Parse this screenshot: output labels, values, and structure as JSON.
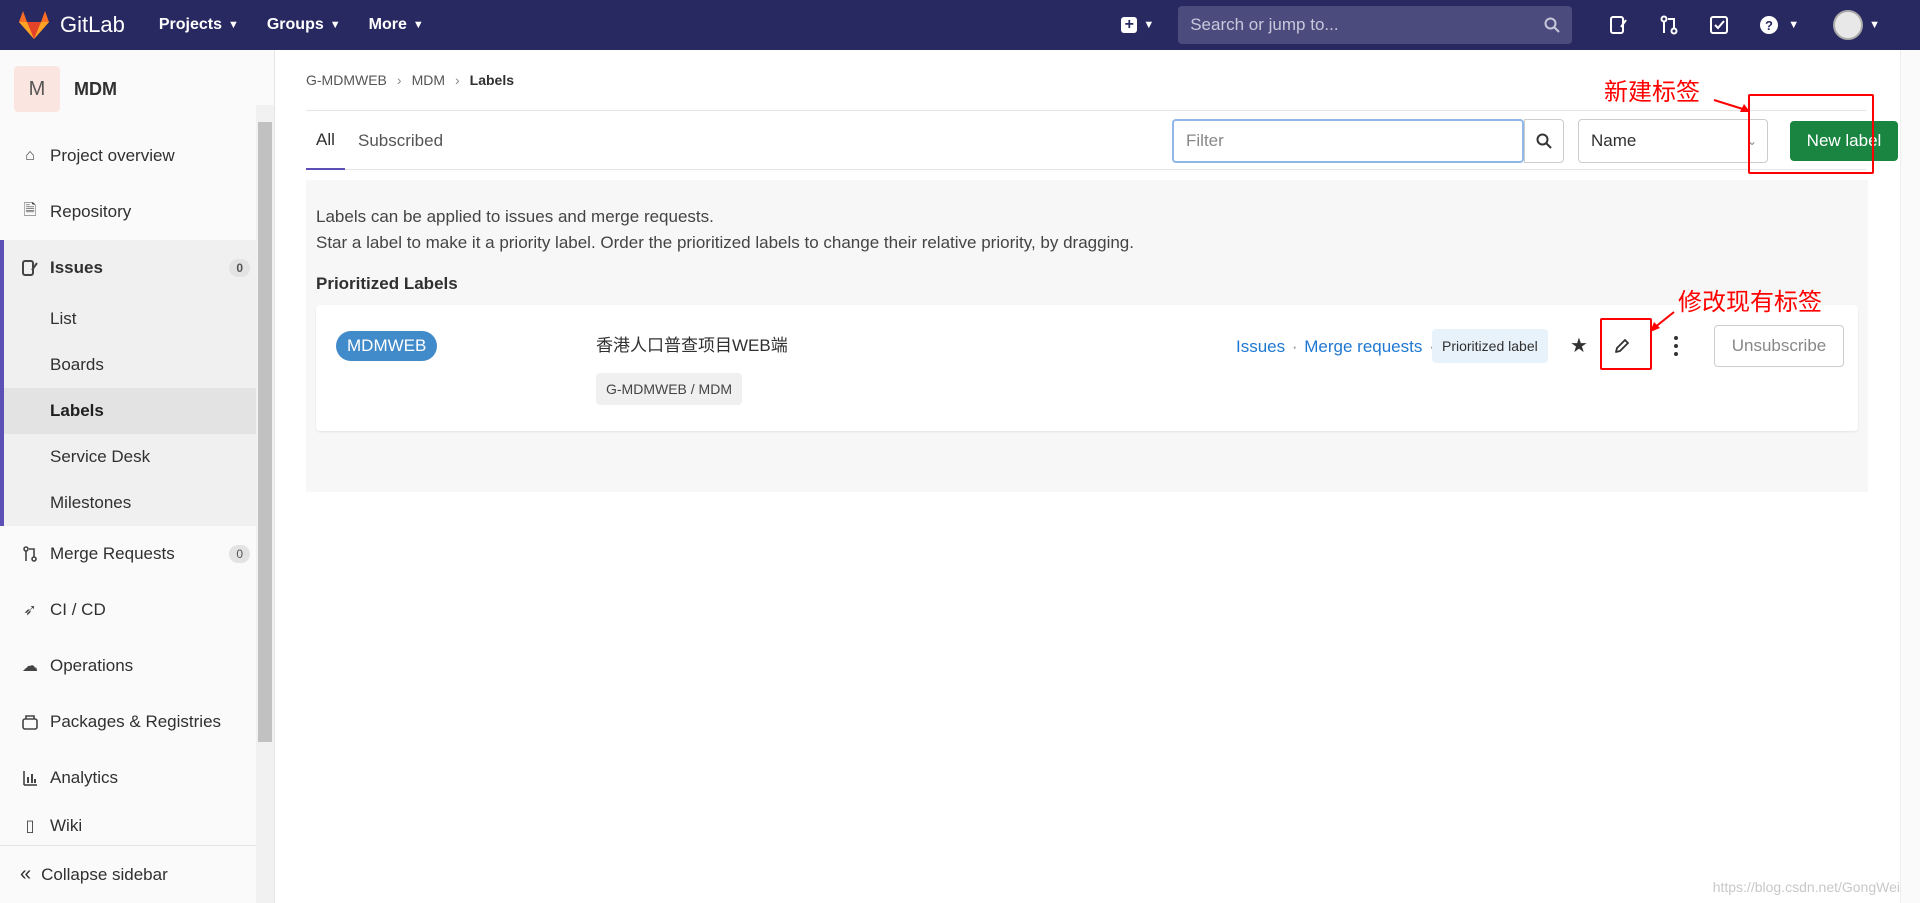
{
  "navbar": {
    "brand": "GitLab",
    "menu": [
      {
        "label": "Projects"
      },
      {
        "label": "Groups"
      },
      {
        "label": "More"
      }
    ],
    "search_placeholder": "Search or jump to..."
  },
  "sidebar": {
    "project_initial": "M",
    "project_name": "MDM",
    "items_top": [
      {
        "label": "Project overview",
        "icon": "home-icon"
      },
      {
        "label": "Repository",
        "icon": "document-icon"
      }
    ],
    "issues": {
      "label": "Issues",
      "count": "0",
      "sub": [
        "List",
        "Boards",
        "Labels",
        "Service Desk",
        "Milestones"
      ]
    },
    "items_bottom": [
      {
        "label": "Merge Requests",
        "count": "0",
        "icon": "merge-request-icon"
      },
      {
        "label": "CI / CD",
        "icon": "rocket-icon"
      },
      {
        "label": "Operations",
        "icon": "cloud-gear-icon"
      },
      {
        "label": "Packages & Registries",
        "icon": "package-icon"
      },
      {
        "label": "Analytics",
        "icon": "chart-icon"
      },
      {
        "label": "Wiki",
        "icon": "book-icon"
      }
    ],
    "collapse_label": "Collapse sidebar"
  },
  "breadcrumb": [
    "G-MDMWEB",
    "MDM",
    "Labels"
  ],
  "tabs": [
    {
      "label": "All"
    },
    {
      "label": "Subscribed"
    }
  ],
  "filter": {
    "placeholder": "Filter"
  },
  "sort": {
    "selected": "Name"
  },
  "new_label_button": "New label",
  "description": [
    "Labels can be applied to issues and merge requests.",
    "Star a label to make it a priority label. Order the prioritized labels to change their relative priority, by dragging."
  ],
  "prioritized_title": "Prioritized Labels",
  "label_row": {
    "name": "MDMWEB",
    "color": "#428bca",
    "description": "香港人口普查项目WEB端",
    "group_path": "G-MDMWEB / MDM",
    "links": [
      "Issues",
      "Merge requests"
    ],
    "priority_badge": "Prioritized label",
    "unsubscribe": "Unsubscribe"
  },
  "annotations": {
    "new_label": "新建标签",
    "edit_label": "修改现有标签"
  },
  "watermark": "https://blog.csdn.net/GongWei"
}
